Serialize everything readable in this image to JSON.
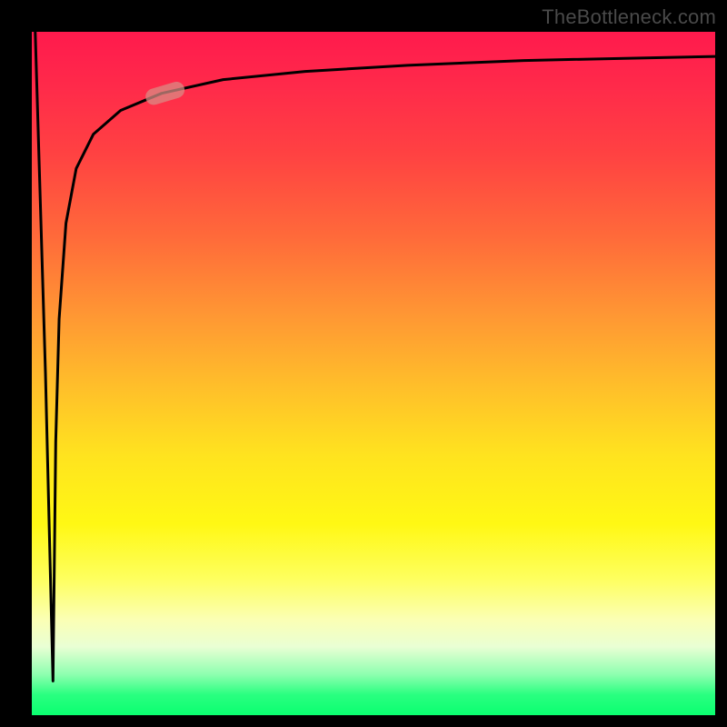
{
  "watermark": "TheBottleneck.com",
  "chart_data": {
    "type": "line",
    "title": "",
    "xlabel": "",
    "ylabel": "",
    "xlim": [
      0,
      100
    ],
    "ylim": [
      0,
      100
    ],
    "grid": false,
    "background_gradient": {
      "type": "vertical",
      "stops": [
        {
          "pos": 0.0,
          "color": "#ff1a4d"
        },
        {
          "pos": 0.5,
          "color": "#ffbf2a"
        },
        {
          "pos": 0.78,
          "color": "#feff5e"
        },
        {
          "pos": 0.95,
          "color": "#2aff80"
        },
        {
          "pos": 1.0,
          "color": "#0aff70"
        }
      ]
    },
    "series": [
      {
        "name": "downstroke",
        "x": [
          0.5,
          2.0,
          3.1
        ],
        "y": [
          100,
          50,
          5
        ]
      },
      {
        "name": "asymptote-curve",
        "x": [
          3.1,
          3.5,
          4.0,
          5.0,
          6.5,
          9.0,
          13.0,
          19.0,
          28.0,
          40.0,
          55.0,
          72.0,
          100.0
        ],
        "y": [
          5,
          40,
          58,
          72,
          80,
          85,
          88.5,
          91,
          93,
          94.2,
          95.1,
          95.8,
          96.4
        ]
      }
    ],
    "marker": {
      "series": "asymptote-curve",
      "x": 19.5,
      "y": 91,
      "shape": "rounded-capsule",
      "color": "#d88f87",
      "opacity": 0.72
    }
  }
}
